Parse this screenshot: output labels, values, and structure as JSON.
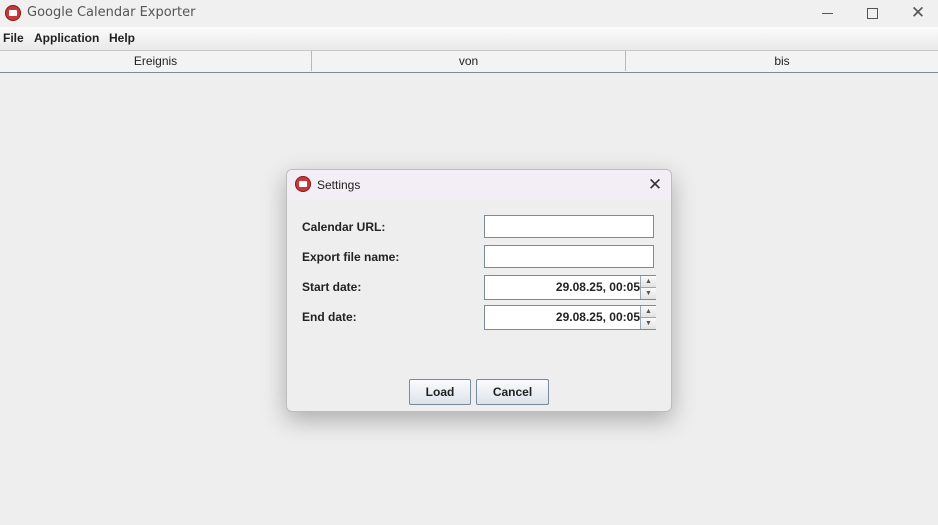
{
  "window": {
    "title": "Google Calendar Exporter",
    "icon": "calendar-icon",
    "controls": {
      "minimize": "minimize-icon",
      "maximize": "maximize-icon",
      "close": "✕"
    }
  },
  "menubar": {
    "items": [
      "File",
      "Application",
      "Help"
    ]
  },
  "table": {
    "columns": [
      "Ereignis",
      "von",
      "bis"
    ]
  },
  "dialog": {
    "title": "Settings",
    "close_symbol": "✕",
    "fields": {
      "calendar_url": {
        "label": "Calendar URL:",
        "value": ""
      },
      "export_file_name": {
        "label": "Export file name:",
        "value": ""
      },
      "start_date": {
        "label": "Start date:",
        "value": "29.08.25, 00:05"
      },
      "end_date": {
        "label": "End date:",
        "value": "29.08.25, 00:05"
      }
    },
    "spinner_up": "▲",
    "spinner_down": "▼",
    "buttons": {
      "load": "Load",
      "cancel": "Cancel"
    }
  },
  "colors": {
    "background": "#eeeeee",
    "dialog_title_bg": "#f3eef6",
    "app_icon": "#c33a3a",
    "border": "#7a8a99"
  }
}
